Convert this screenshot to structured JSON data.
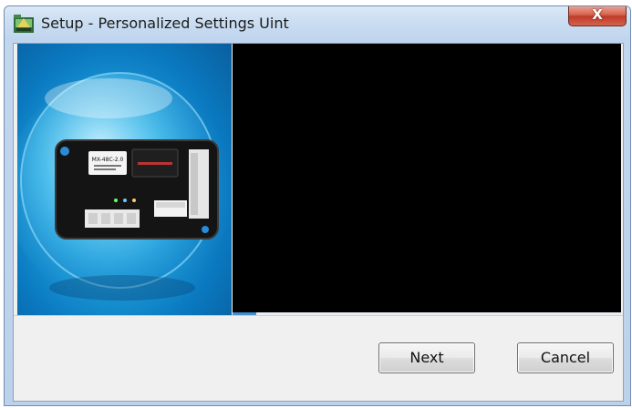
{
  "window": {
    "title": "Setup - Personalized Settings Uint",
    "icons": {
      "app": "setup-app-icon",
      "close": "close-icon"
    },
    "close_glyph": "X"
  },
  "side_image": {
    "device_label": "MX-48C-2.0",
    "alt": "controller-device-image"
  },
  "video": {
    "progress": 0.06
  },
  "buttons": {
    "next": "Next",
    "cancel": "Cancel"
  },
  "colors": {
    "title_bar": "#c9dcf1",
    "close_button": "#c0392a",
    "video_background": "#000000",
    "image_background": "#1fa2de",
    "progress": "#3f8fd6"
  }
}
